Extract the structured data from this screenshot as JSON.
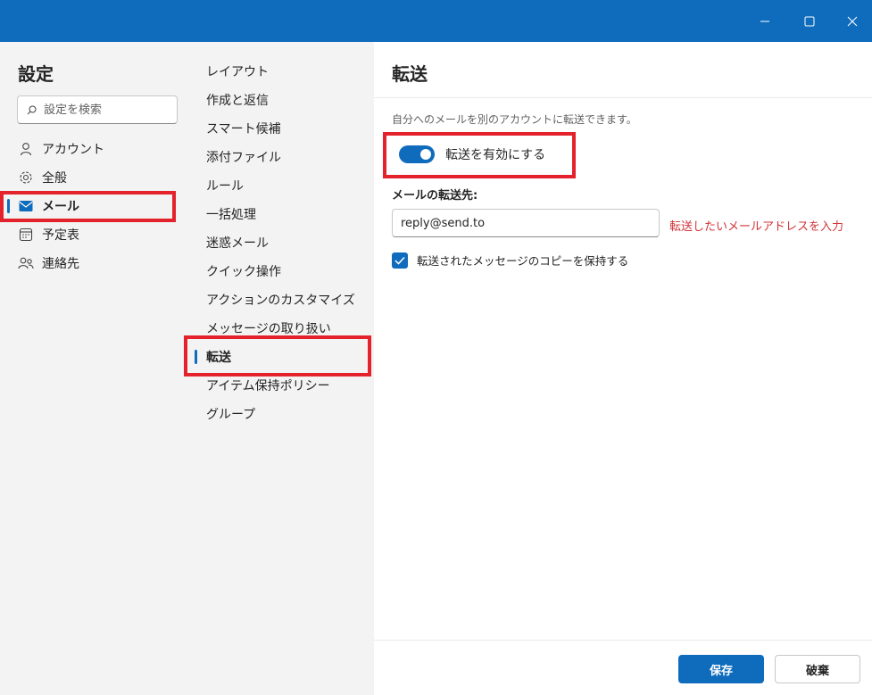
{
  "window": {
    "controls": [
      "minimize-icon",
      "maximize-icon",
      "close-icon"
    ],
    "accent_color": "#0f6cbd"
  },
  "left": {
    "title": "設定",
    "search_placeholder": "設定を検索",
    "items": [
      {
        "label": "アカウント",
        "icon": "person-icon"
      },
      {
        "label": "全般",
        "icon": "gear-icon"
      },
      {
        "label": "メール",
        "icon": "mail-icon",
        "active": true
      },
      {
        "label": "予定表",
        "icon": "calendar-icon"
      },
      {
        "label": "連絡先",
        "icon": "people-icon"
      }
    ]
  },
  "middle": {
    "items": [
      {
        "label": "レイアウト"
      },
      {
        "label": "作成と返信"
      },
      {
        "label": "スマート候補"
      },
      {
        "label": "添付ファイル"
      },
      {
        "label": "ルール"
      },
      {
        "label": "一括処理"
      },
      {
        "label": "迷惑メール"
      },
      {
        "label": "クイック操作"
      },
      {
        "label": "アクションのカスタマイズ"
      },
      {
        "label": "メッセージの取り扱い"
      },
      {
        "label": "転送",
        "active": true
      },
      {
        "label": "アイテム保持ポリシー"
      },
      {
        "label": "グループ"
      }
    ]
  },
  "main": {
    "title": "転送",
    "description": "自分へのメールを別のアカウントに転送できます。",
    "toggle_label": "転送を有効にする",
    "toggle_on": true,
    "forward_label": "メールの転送先:",
    "forward_value": "reply@send.to",
    "annotation": "転送したいメールアドレスを入力",
    "keep_copy_label": "転送されたメッセージのコピーを保持する",
    "keep_copy_checked": true,
    "save_label": "保存",
    "discard_label": "破棄"
  },
  "highlight_color": "#e3222b"
}
